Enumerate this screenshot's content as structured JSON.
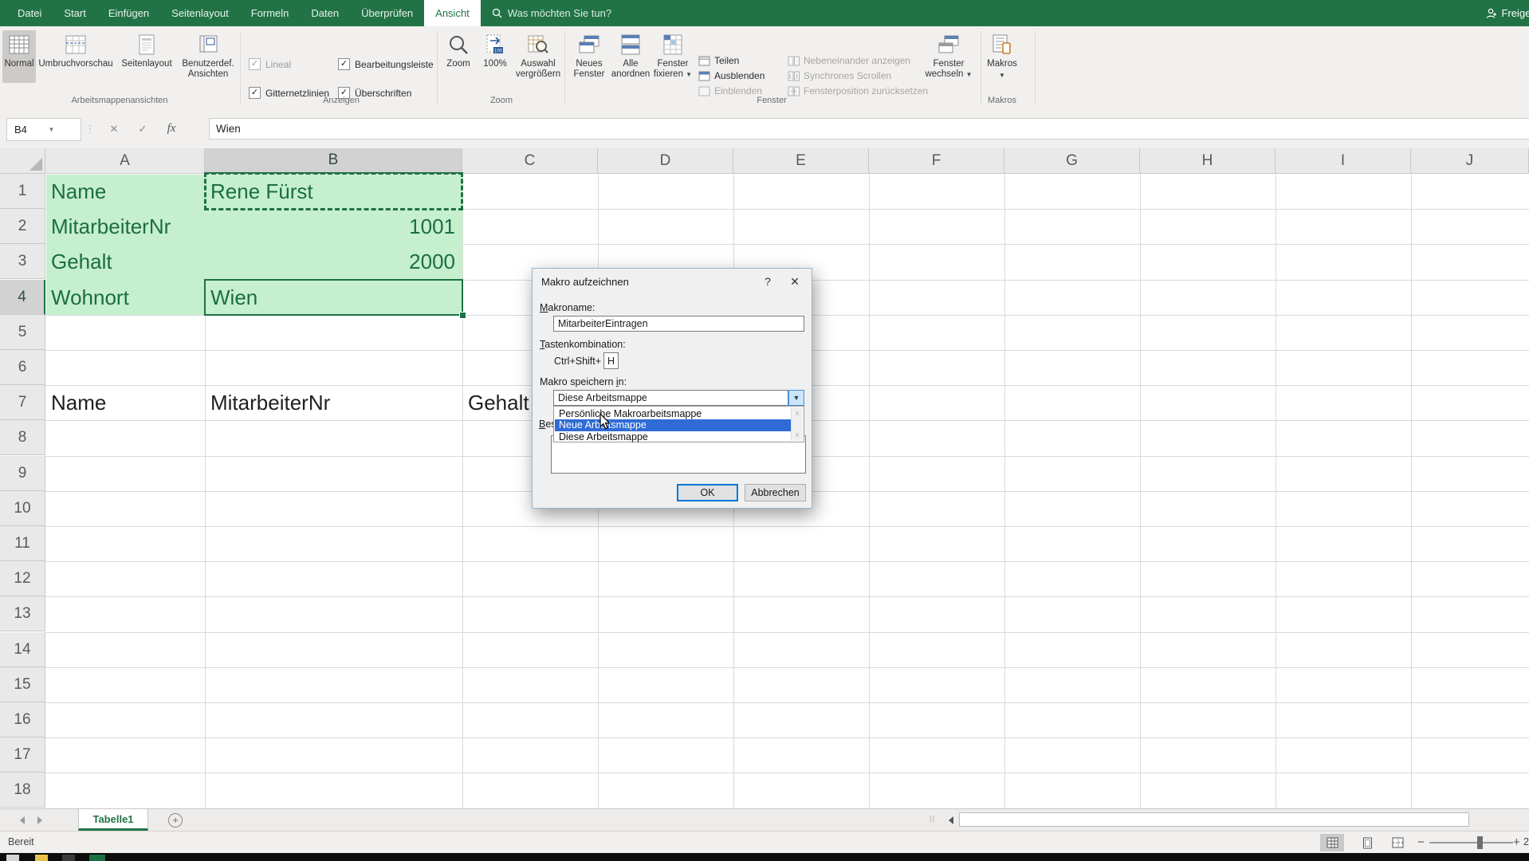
{
  "colors": {
    "excel_green": "#217346",
    "cell_fill": "#c6efce",
    "cell_text": "#1b6e43",
    "list_highlight": "#2e6bd6",
    "default_button_border": "#0078d7"
  },
  "titlebar": {
    "share_label": "Freigeben"
  },
  "ribbon": {
    "tabs": [
      {
        "label": "Datei",
        "active": false
      },
      {
        "label": "Start",
        "active": false
      },
      {
        "label": "Einfügen",
        "active": false
      },
      {
        "label": "Seitenlayout",
        "active": false
      },
      {
        "label": "Formeln",
        "active": false
      },
      {
        "label": "Daten",
        "active": false
      },
      {
        "label": "Überprüfen",
        "active": false
      },
      {
        "label": "Ansicht",
        "active": true
      }
    ],
    "search_label": "Was möchten Sie tun?",
    "group_labels": {
      "views": "Arbeitsmappenansichten",
      "show": "Anzeigen",
      "zoom": "Zoom",
      "window": "Fenster",
      "macros": "Makros"
    },
    "views": {
      "normal": "Normal",
      "pagebreak": "Umbruchvorschau",
      "pagelayout": "Seitenlayout",
      "custom1": "Benutzerdef.",
      "custom2": "Ansichten"
    },
    "show": {
      "ruler": "Lineal",
      "gridlines": "Gitternetzlinien",
      "formulabar": "Bearbeitungsleiste",
      "headings": "Überschriften"
    },
    "zoom": {
      "zoom": "Zoom",
      "hundred": "100%",
      "sel1": "Auswahl",
      "sel2": "vergrößern"
    },
    "window": {
      "new1": "Neues",
      "new2": "Fenster",
      "arr1": "Alle",
      "arr2": "anordnen",
      "frz1": "Fenster",
      "frz2": "fixieren",
      "split": "Teilen",
      "hide": "Ausblenden",
      "unhide": "Einblenden",
      "side": "Nebeneinander anzeigen",
      "sync": "Synchrones Scrollen",
      "reset": "Fensterposition zurücksetzen",
      "switch1": "Fenster",
      "switch2": "wechseln"
    },
    "macros_label": "Makros"
  },
  "formula_bar": {
    "name_box": "B4",
    "value": "Wien",
    "fx": "fx"
  },
  "grid": {
    "columns": [
      "A",
      "B",
      "C",
      "D",
      "E",
      "F",
      "G",
      "H",
      "I",
      "J"
    ],
    "selected_column": "B",
    "row_count": 18,
    "selected_row": 4,
    "active_cell": "B4",
    "marching_ants_cell": "B1",
    "green_cells": [
      {
        "row": 1,
        "col": "A",
        "text": "Name",
        "align": "left"
      },
      {
        "row": 1,
        "col": "B",
        "text": "Rene Fürst",
        "align": "left"
      },
      {
        "row": 2,
        "col": "A",
        "text": "MitarbeiterNr",
        "align": "left"
      },
      {
        "row": 2,
        "col": "B",
        "text": "1001",
        "align": "right"
      },
      {
        "row": 3,
        "col": "A",
        "text": "Gehalt",
        "align": "left"
      },
      {
        "row": 3,
        "col": "B",
        "text": "2000",
        "align": "right"
      },
      {
        "row": 4,
        "col": "A",
        "text": "Wohnort",
        "align": "left"
      },
      {
        "row": 4,
        "col": "B",
        "text": "Wien",
        "align": "left"
      }
    ],
    "plain_cells": [
      {
        "row": 7,
        "col": "A",
        "text": "Name",
        "align": "left"
      },
      {
        "row": 7,
        "col": "B",
        "text": "MitarbeiterNr",
        "align": "left"
      },
      {
        "row": 7,
        "col": "C",
        "text": "Gehalt",
        "align": "left"
      }
    ]
  },
  "dialog": {
    "title": "Makro aufzeichnen",
    "help_glyph": "?",
    "close_glyph": "✕",
    "macro_name_label": {
      "pre": "",
      "accel": "M",
      "post": "akroname:"
    },
    "macro_name_value": "MitarbeiterEintragen",
    "shortcut_label": {
      "pre": "",
      "accel": "T",
      "post": "astenkombination:"
    },
    "shortcut_prefix": "Ctrl+Shift+",
    "shortcut_key": "H",
    "store_label": {
      "pre": "Makro speichern ",
      "accel": "i",
      "post": "n:"
    },
    "store_value": "Diese Arbeitsmappe",
    "store_options": [
      "Persönliche Makroarbeitsmappe",
      "Neue Arbeitsmappe",
      "Diese Arbeitsmappe"
    ],
    "highlighted_index": 1,
    "description_label": {
      "pre": "",
      "accel": "B",
      "post": "eschreibung:"
    },
    "ok_label": "OK",
    "cancel_label": "Abbrechen"
  },
  "sheet_bar": {
    "active_tab": "Tabelle1"
  },
  "status_bar": {
    "status": "Bereit",
    "zoom_clipped": "2"
  }
}
